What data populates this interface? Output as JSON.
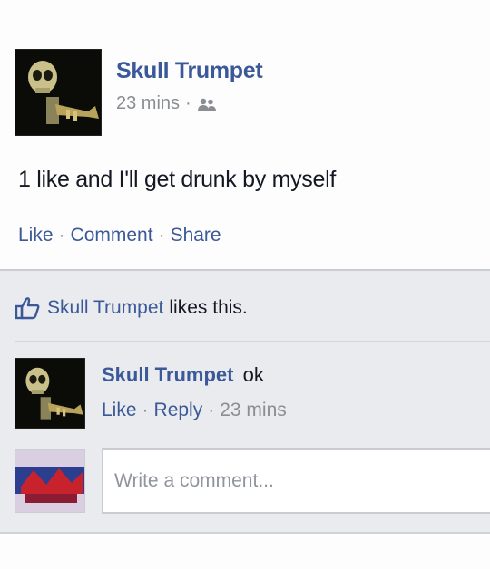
{
  "post": {
    "author": "Skull Trumpet",
    "time": "23 mins",
    "separator": "·",
    "audience_icon": "friends-icon",
    "text": "1 like and I'll get drunk by myself",
    "actions": {
      "like": "Like",
      "comment": "Comment",
      "share": "Share"
    }
  },
  "feedback": {
    "liker": "Skull Trumpet",
    "likes_suffix": "likes this.",
    "comment": {
      "author": "Skull Trumpet",
      "text": "ok",
      "like": "Like",
      "reply": "Reply",
      "time": "23 mins"
    },
    "composer": {
      "placeholder": "Write a comment..."
    }
  },
  "colors": {
    "link": "#3b5998",
    "meta": "#8a8d91",
    "feedback_bg": "#e9ebee"
  }
}
